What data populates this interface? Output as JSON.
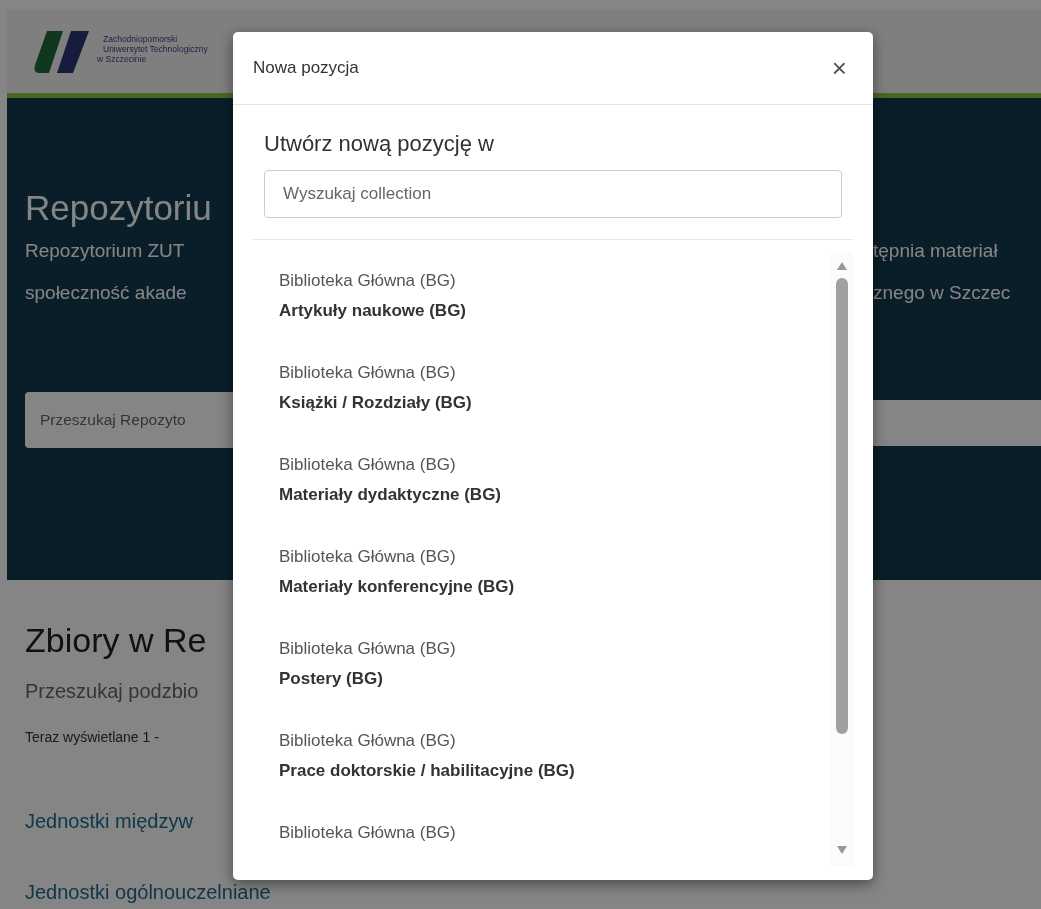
{
  "header": {
    "logo_text": [
      "Zachodniopomorski",
      "Uniwersytet Technologiczny",
      "w Szczecinie"
    ]
  },
  "hero": {
    "title": "Repozytoriu",
    "description": [
      {
        "left": "Repozytorium ZUT",
        "right": "tępnia materiał"
      },
      {
        "left": "społeczność akade",
        "right": "znego w Szczec"
      }
    ],
    "search": {
      "placeholder": "Przeszukaj Repozyto"
    }
  },
  "content": {
    "heading": "Zbiory w Re",
    "subheading": "Przeszukaj podzbio",
    "count": "Teraz wyświetlane 1 -",
    "links": [
      "Jednostki międzyw",
      "Jednostki ogólnouczelniane"
    ]
  },
  "modal": {
    "title": "Nowa pozycja",
    "close": "×",
    "heading": "Utwórz nową pozycję w",
    "search": {
      "placeholder": "Wyszukaj collection"
    },
    "items": [
      {
        "parent": "Biblioteka Główna (BG)",
        "name": "Artykuły naukowe (BG)"
      },
      {
        "parent": "Biblioteka Główna (BG)",
        "name": "Książki / Rozdziały (BG)"
      },
      {
        "parent": "Biblioteka Główna (BG)",
        "name": "Materiały dydaktyczne (BG)"
      },
      {
        "parent": "Biblioteka Główna (BG)",
        "name": "Materiały konferencyjne (BG)"
      },
      {
        "parent": "Biblioteka Główna (BG)",
        "name": "Postery (BG)"
      },
      {
        "parent": "Biblioteka Główna (BG)",
        "name": "Prace doktorskie / habilitacyjne (BG)"
      },
      {
        "parent": "Biblioteka Główna (BG)"
      }
    ]
  }
}
